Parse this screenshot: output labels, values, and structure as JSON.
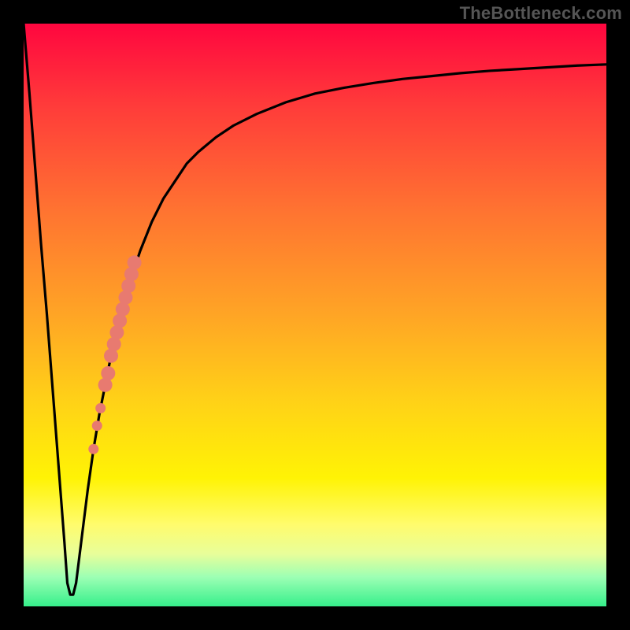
{
  "watermark": "TheBottleneck.com",
  "colors": {
    "frame": "#000000",
    "curve": "#000000",
    "marker": "#e87a70",
    "gradient_top": "#ff063f",
    "gradient_bottom": "#36ef8b"
  },
  "chart_data": {
    "type": "line",
    "title": "",
    "xlabel": "",
    "ylabel": "",
    "xlim": [
      0,
      100
    ],
    "ylim": [
      0,
      100
    ],
    "grid": false,
    "legend": false,
    "note": "Bottleneck-style curve on a red-to-green vertical gradient. Higher y = worse (red), lower y = better (green). Values estimated from pixel heights; no axis ticks are shown in the image.",
    "series": [
      {
        "name": "bottleneck-curve",
        "x": [
          0,
          1,
          2,
          3,
          4,
          5,
          6,
          7,
          7.5,
          8,
          8.5,
          9,
          10,
          11,
          12,
          13,
          14,
          15,
          16,
          18,
          20,
          22,
          24,
          26,
          28,
          30,
          33,
          36,
          40,
          45,
          50,
          55,
          60,
          65,
          70,
          75,
          80,
          85,
          90,
          95,
          100
        ],
        "y": [
          100,
          88,
          75,
          62,
          50,
          37,
          24,
          11,
          4,
          2,
          2,
          4,
          12,
          20,
          27,
          33,
          38,
          43,
          47,
          55,
          61,
          66,
          70,
          73,
          76,
          78,
          80.5,
          82.5,
          84.5,
          86.5,
          88,
          89,
          89.8,
          90.5,
          91,
          91.5,
          91.9,
          92.2,
          92.5,
          92.8,
          93
        ]
      }
    ],
    "markers": {
      "name": "highlight-segment",
      "shape": "circle",
      "color": "#e87a70",
      "points": [
        {
          "x": 14,
          "y": 38
        },
        {
          "x": 14.5,
          "y": 40
        },
        {
          "x": 15,
          "y": 43
        },
        {
          "x": 15.5,
          "y": 45
        },
        {
          "x": 16,
          "y": 47
        },
        {
          "x": 16.5,
          "y": 49
        },
        {
          "x": 17,
          "y": 51
        },
        {
          "x": 17.5,
          "y": 53
        },
        {
          "x": 18,
          "y": 55
        },
        {
          "x": 18.5,
          "y": 57
        },
        {
          "x": 19,
          "y": 59
        }
      ],
      "extra_dots": [
        {
          "x": 13.2,
          "y": 34
        },
        {
          "x": 12.6,
          "y": 31
        },
        {
          "x": 12.0,
          "y": 27
        }
      ]
    }
  }
}
